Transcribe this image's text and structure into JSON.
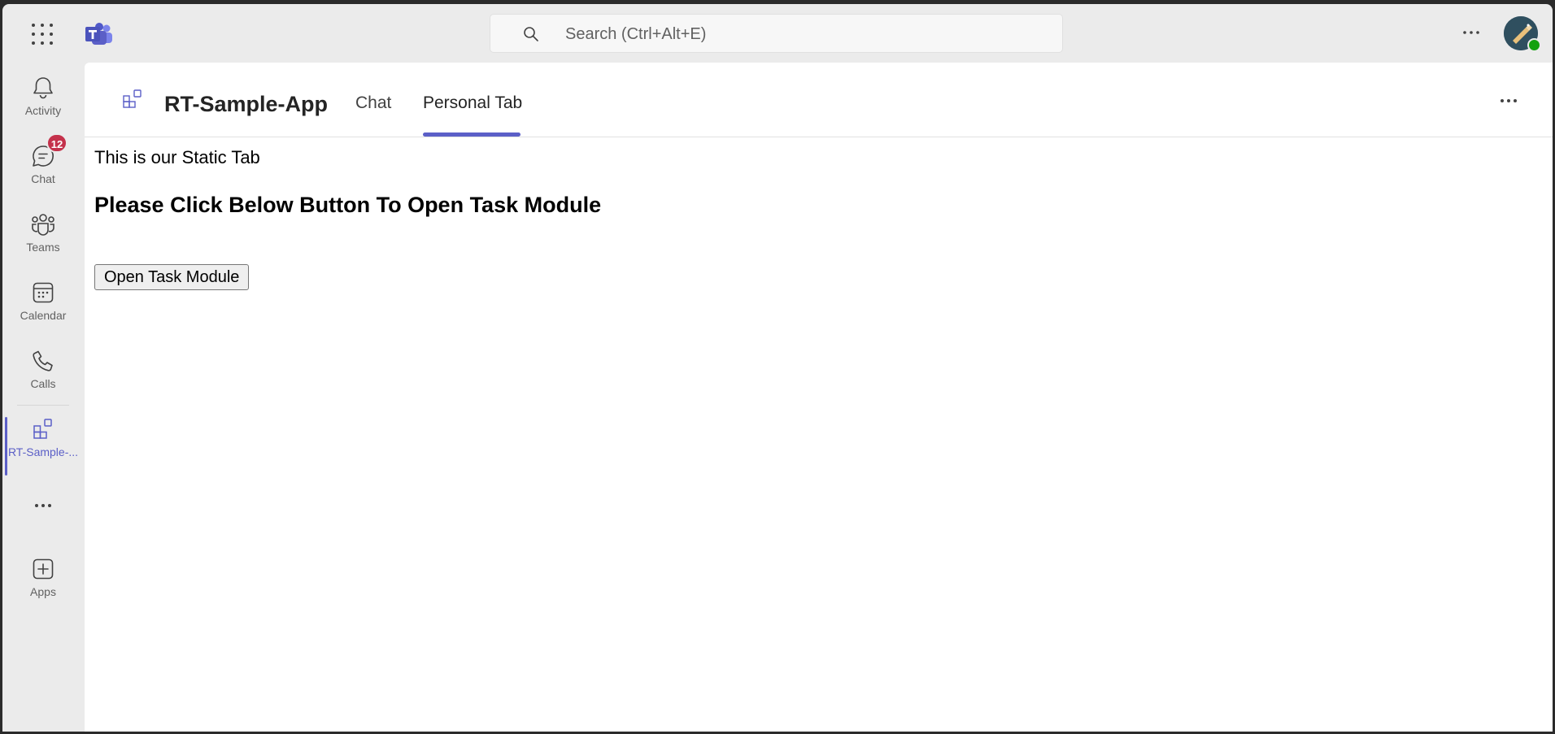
{
  "topbar": {
    "search_placeholder": "Search (Ctrl+Alt+E)",
    "icons": [
      "waffle-icon",
      "teams-logo-icon",
      "search-icon",
      "more-icon",
      "avatar"
    ]
  },
  "rail": {
    "items": [
      {
        "label": "Activity",
        "icon": "bell-icon"
      },
      {
        "label": "Chat",
        "icon": "chat-icon",
        "badge": "12"
      },
      {
        "label": "Teams",
        "icon": "teams-icon"
      },
      {
        "label": "Calendar",
        "icon": "calendar-icon"
      },
      {
        "label": "Calls",
        "icon": "phone-icon"
      },
      {
        "label": "RT-Sample-...",
        "icon": "app-grid-icon",
        "active": true
      },
      {
        "label": "",
        "icon": "more-icon"
      },
      {
        "label": "Apps",
        "icon": "add-app-icon"
      }
    ]
  },
  "app": {
    "title": "RT-Sample-App",
    "tabs": [
      {
        "label": "Chat",
        "active": false
      },
      {
        "label": "Personal Tab",
        "active": true
      }
    ]
  },
  "content": {
    "static_text": "This is our Static Tab",
    "heading": "Please Click Below Button To Open Task Module",
    "button_label": "Open Task Module"
  },
  "colors": {
    "accent": "#5b5fc7",
    "badge": "#c4314b",
    "presence": "#13a10e",
    "chrome": "#ebebeb"
  }
}
